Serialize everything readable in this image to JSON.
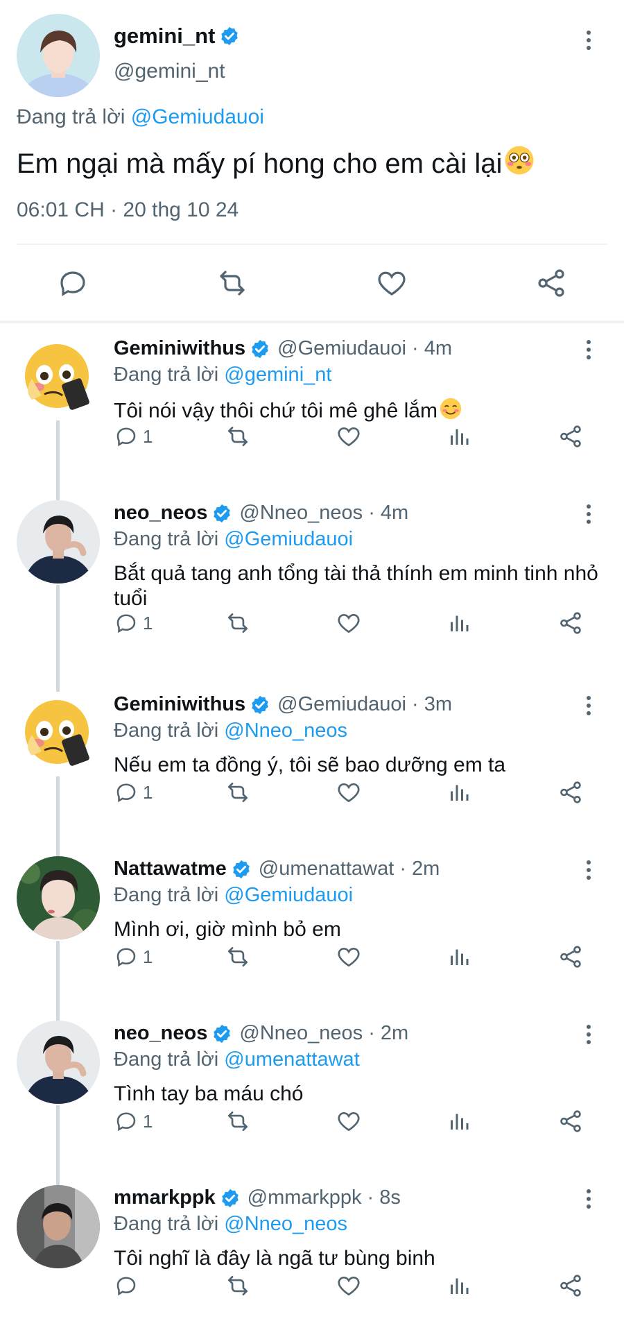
{
  "main_tweet": {
    "display_name": "gemini_nt",
    "handle": "@gemini_nt",
    "replying_label": "Đang trả lời",
    "replying_to": "@Gemiudauoi",
    "text": "Em ngại mà mấy pí hong cho em cài lại",
    "timestamp": "06:01 CH · 20 thg 10 24"
  },
  "replies": [
    {
      "display_name": "Geminiwithus",
      "handle": "@Gemiudauoi · 4m",
      "replying_label": "Đang trả lời",
      "replying_to": "@gemini_nt",
      "text": "Tôi nói vậy thôi chứ tôi mê ghê lắm",
      "reply_count": "1"
    },
    {
      "display_name": "neo_neos",
      "handle": "@Nneo_neos · 4m",
      "replying_label": "Đang trả lời",
      "replying_to": "@Gemiudauoi",
      "text": "Bắt quả tang anh tổng tài thả thính em minh tinh nhỏ tuổi",
      "reply_count": "1"
    },
    {
      "display_name": "Geminiwithus",
      "handle": "@Gemiudauoi · 3m",
      "replying_label": "Đang trả lời",
      "replying_to": "@Nneo_neos",
      "text": "Nếu em ta đồng ý, tôi sẽ bao dưỡng em ta",
      "reply_count": "1"
    },
    {
      "display_name": "Nattawatme",
      "handle": "@umenattawat · 2m",
      "replying_label": "Đang trả lời",
      "replying_to": "@Gemiudauoi",
      "text": "Mình ơi, giờ mình bỏ em",
      "reply_count": "1"
    },
    {
      "display_name": "neo_neos",
      "handle": "@Nneo_neos · 2m",
      "replying_label": "Đang trả lời",
      "replying_to": "@umenattawat",
      "text": "Tình tay ba máu chó",
      "reply_count": "1"
    },
    {
      "display_name": "mmarkppk",
      "handle": "@mmarkppk · 8s",
      "replying_label": "Đang trả lời",
      "replying_to": "@Nneo_neos",
      "text": "Tôi nghĩ là đây là ngã tư bùng binh",
      "reply_count": ""
    }
  ],
  "colors": {
    "accent": "#1d9bf0",
    "secondary_text": "#536471",
    "primary_text": "#0f1419",
    "divider": "#eff3f4"
  }
}
